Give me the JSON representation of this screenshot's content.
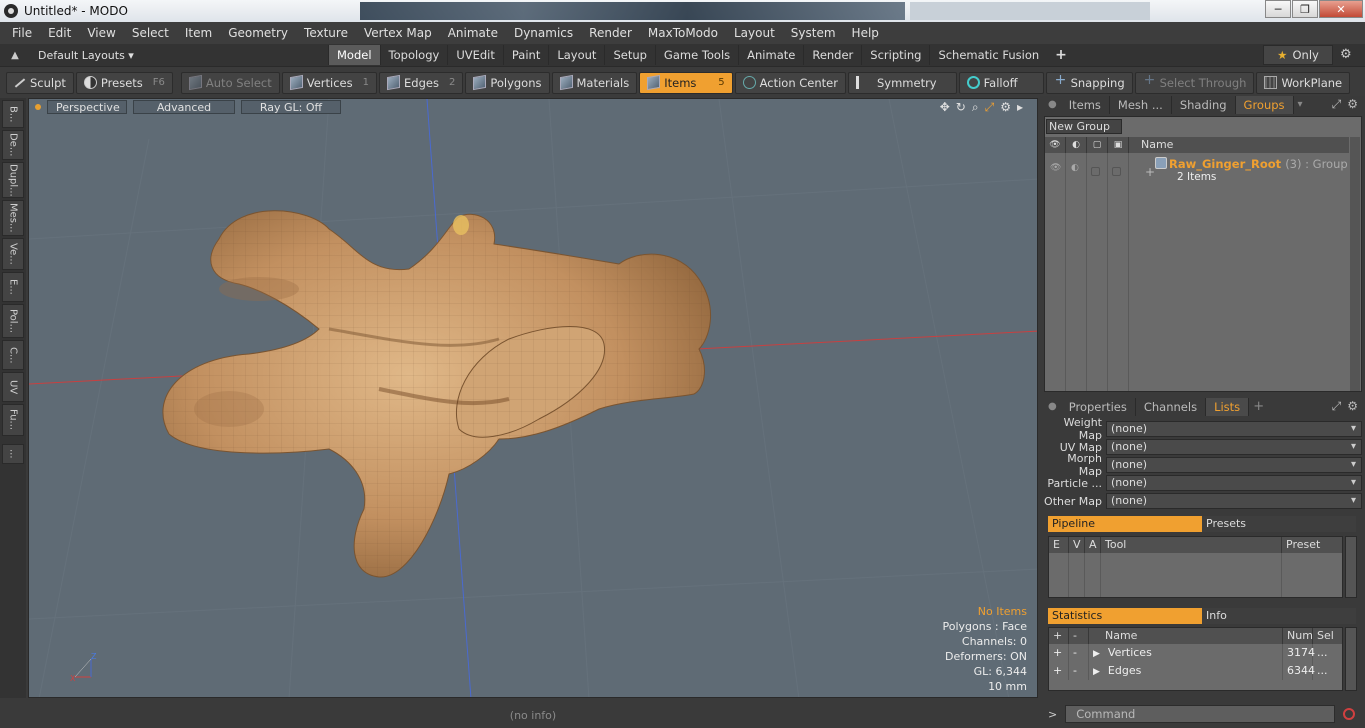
{
  "window": {
    "title": "Untitled* - MODO",
    "minimize": "─",
    "maximize": "❐",
    "close": "✕"
  },
  "menu": [
    "File",
    "Edit",
    "View",
    "Select",
    "Item",
    "Geometry",
    "Texture",
    "Vertex Map",
    "Animate",
    "Dynamics",
    "Render",
    "MaxToModo",
    "Layout",
    "System",
    "Help"
  ],
  "layouts": {
    "dropdown": "Default Layouts ▾",
    "tabs": [
      "Model",
      "Topology",
      "UVEdit",
      "Paint",
      "Layout",
      "Setup",
      "Game Tools",
      "Animate",
      "Render",
      "Scripting",
      "Schematic Fusion"
    ],
    "active": "Model",
    "plus": "+",
    "only_label": "Only",
    "star": "★"
  },
  "toolbar": {
    "sculpt": "Sculpt",
    "presets": "Presets",
    "presets_key": "F6",
    "auto_select": "Auto Select",
    "vertices": "Vertices",
    "vertices_key": "1",
    "edges": "Edges",
    "edges_key": "2",
    "polygons": "Polygons",
    "materials": "Materials",
    "items": "Items",
    "items_key": "5",
    "action_center": "Action Center",
    "symmetry": "Symmetry",
    "falloff": "Falloff",
    "snapping": "Snapping",
    "select_through": "Select Through",
    "workplane": "WorkPlane"
  },
  "left_tabs": [
    "B...",
    "De...",
    "Dupl...",
    "Mes...",
    "Ve...",
    "E...",
    "Pol...",
    "C...",
    "UV",
    "Fu...",
    "..."
  ],
  "viewport": {
    "view": "Perspective",
    "advanced": "Advanced",
    "raygl": "Ray GL: Off",
    "stats": {
      "selection": "No Items",
      "polygons": "Polygons : Face",
      "channels": "Channels: 0",
      "deformers": "Deformers: ON",
      "gl": "GL: 6,344",
      "scale": "10 mm"
    },
    "axis": {
      "z": "Z",
      "x": "X"
    }
  },
  "status": {
    "info": "(no info)"
  },
  "command": {
    "prompt": ">",
    "placeholder": "Command"
  },
  "groups_panel": {
    "tabs": [
      "Items",
      "Mesh ...",
      "Shading",
      "Groups"
    ],
    "active": "Groups",
    "new_group": "New Group",
    "name_header": "Name",
    "group": {
      "name": "Raw_Ginger_Root",
      "meta": "(3) : Group",
      "subtitle": "2 Items"
    }
  },
  "lists_panel": {
    "tabs": [
      "Properties",
      "Channels",
      "Lists"
    ],
    "active": "Lists",
    "plus": "+",
    "rows": [
      {
        "label": "Weight Map",
        "value": "(none)"
      },
      {
        "label": "UV Map",
        "value": "(none)"
      },
      {
        "label": "Morph Map",
        "value": "(none)"
      },
      {
        "label": "Particle ...",
        "value": "(none)"
      },
      {
        "label": "Other Map",
        "value": "(none)"
      }
    ],
    "pipeline_tab": "Pipeline",
    "presets_tab": "Presets",
    "pipeline_columns": [
      "E",
      "V",
      "A",
      "Tool",
      "Preset"
    ],
    "statistics_tab": "Statistics",
    "info_tab": "Info",
    "stats_columns": [
      "+",
      "-",
      "Name",
      "Num",
      "Sel"
    ],
    "stats_rows": [
      {
        "plus": "+",
        "minus": "-",
        "name": "Vertices",
        "num": "3174",
        "sel": "..."
      },
      {
        "plus": "+",
        "minus": "-",
        "name": "Edges",
        "num": "6344",
        "sel": "..."
      }
    ]
  },
  "colors": {
    "accent": "#f0a030",
    "viewport_bg": "#5f6b75",
    "ginger": "#c89a68"
  }
}
